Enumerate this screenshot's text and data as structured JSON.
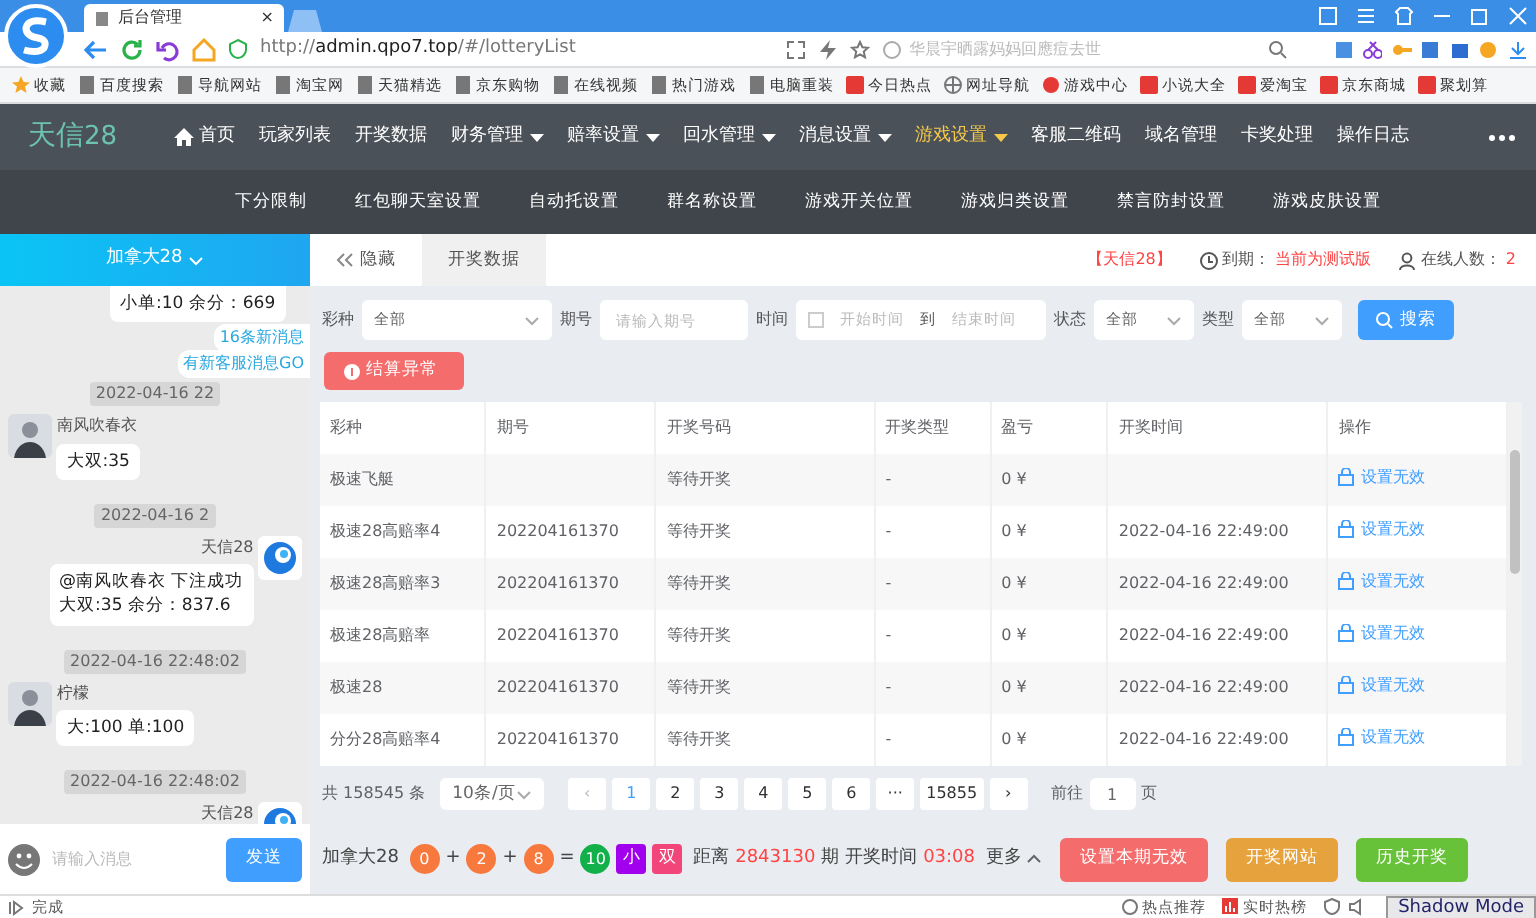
{
  "browser": {
    "tab_title": "后台管理",
    "tab_close": "×",
    "url_prefix": "http://",
    "url_host": "admin.qpo7.top",
    "url_path": "/#/lotteryList",
    "search_placeholder": "华晨宇晒露妈妈回應痘去世",
    "bookmarks": [
      {
        "label": "收藏",
        "kind": "star"
      },
      {
        "label": "百度搜索",
        "kind": "page"
      },
      {
        "label": "导航网站",
        "kind": "page"
      },
      {
        "label": "淘宝网",
        "kind": "page"
      },
      {
        "label": "天猫精选",
        "kind": "page"
      },
      {
        "label": "京东购物",
        "kind": "page"
      },
      {
        "label": "在线视频",
        "kind": "page"
      },
      {
        "label": "热门游戏",
        "kind": "page"
      },
      {
        "label": "电脑重装",
        "kind": "page"
      },
      {
        "label": "今日热点",
        "kind": "red"
      },
      {
        "label": "网址导航",
        "kind": "globe"
      },
      {
        "label": "游戏中心",
        "kind": "game"
      },
      {
        "label": "小说大全",
        "kind": "red"
      },
      {
        "label": "爱淘宝",
        "kind": "red"
      },
      {
        "label": "京东商城",
        "kind": "red"
      },
      {
        "label": "聚划算",
        "kind": "red"
      }
    ]
  },
  "app": {
    "logo_text": "天信",
    "logo_number": "28",
    "nav": [
      {
        "label": "首页",
        "kind": "home",
        "dropdown": false,
        "selected": false
      },
      {
        "label": "玩家列表",
        "dropdown": false,
        "selected": false
      },
      {
        "label": "开奖数据",
        "dropdown": false,
        "selected": false
      },
      {
        "label": "财务管理",
        "dropdown": true,
        "selected": false
      },
      {
        "label": "赔率设置",
        "dropdown": true,
        "selected": false
      },
      {
        "label": "回水管理",
        "dropdown": true,
        "selected": false
      },
      {
        "label": "消息设置",
        "dropdown": true,
        "selected": false
      },
      {
        "label": "游戏设置",
        "dropdown": true,
        "selected": true
      },
      {
        "label": "客服二维码",
        "dropdown": false,
        "selected": false
      },
      {
        "label": "域名管理",
        "dropdown": false,
        "selected": false
      },
      {
        "label": "卡奖处理",
        "dropdown": false,
        "selected": false
      },
      {
        "label": "操作日志",
        "dropdown": false,
        "selected": false
      }
    ],
    "subnav": [
      "下分限制",
      "红包聊天室设置",
      "自动托设置",
      "群名称设置",
      "游戏开关位置",
      "游戏归类设置",
      "禁言防封设置",
      "游戏皮肤设置"
    ]
  },
  "chat": {
    "room": "加拿大28",
    "notices": [
      "16条新消息",
      "有新客服消息GO"
    ],
    "messages": [
      {
        "kind": "bubble",
        "lines": [
          "小单:10 余分：669"
        ]
      },
      {
        "kind": "time",
        "text": "2022-04-16 22"
      },
      {
        "kind": "user",
        "sender": "南风吹春衣",
        "lines": [
          "大双:35"
        ]
      },
      {
        "kind": "time",
        "text": "2022-04-16 2"
      },
      {
        "kind": "bot",
        "sender": "天信28",
        "lines": [
          "@南风吹春衣 下注成功",
          "大双:35 余分：837.6"
        ]
      },
      {
        "kind": "time",
        "text": "2022-04-16 22:48:02"
      },
      {
        "kind": "user",
        "sender": "柠檬",
        "lines": [
          "大:100 单:100"
        ]
      },
      {
        "kind": "time",
        "text": "2022-04-16 22:48:02"
      },
      {
        "kind": "bot",
        "sender": "天信28"
      }
    ],
    "input_placeholder": "请输入消息",
    "send_label": "发送"
  },
  "tabs": [
    {
      "label": "隐藏",
      "kind": "hide",
      "selected": false
    },
    {
      "label": "开奖数据",
      "selected": true
    }
  ],
  "header_info": {
    "site": "【天信28】",
    "expiry_label": "到期：",
    "expiry_value": "当前为测试版",
    "online_label": "在线人数：",
    "online_value": "2"
  },
  "filters": [
    {
      "label": "彩种",
      "kind": "select",
      "value": "全部"
    },
    {
      "label": "期号",
      "kind": "input",
      "placeholder": "请输入期号"
    },
    {
      "label": "时间",
      "kind": "range",
      "from_placeholder": "开始时间",
      "separator": "到",
      "to_placeholder": "结束时间"
    },
    {
      "label": "状态",
      "kind": "select",
      "value": "全部"
    },
    {
      "label": "类型",
      "kind": "select",
      "value": "全部"
    }
  ],
  "search_label": "搜索",
  "alert_label": "结算异常",
  "table": {
    "columns": [
      "彩种",
      "期号",
      "开奖号码",
      "开奖类型",
      "盈亏",
      "开奖时间",
      "操作"
    ],
    "rows": [
      {
        "cells": [
          "极速飞艇",
          "",
          "等待开奖",
          "-",
          "0 ¥",
          ""
        ],
        "action": "设置无效"
      },
      {
        "cells": [
          "极速28高赔率4",
          "202204161370",
          "等待开奖",
          "-",
          "0 ¥",
          "2022-04-16 22:49:00"
        ],
        "action": "设置无效"
      },
      {
        "cells": [
          "极速28高赔率3",
          "202204161370",
          "等待开奖",
          "-",
          "0 ¥",
          "2022-04-16 22:49:00"
        ],
        "action": "设置无效"
      },
      {
        "cells": [
          "极速28高赔率",
          "202204161370",
          "等待开奖",
          "-",
          "0 ¥",
          "2022-04-16 22:49:00"
        ],
        "action": "设置无效"
      },
      {
        "cells": [
          "极速28",
          "202204161370",
          "等待开奖",
          "-",
          "0 ¥",
          "2022-04-16 22:49:00"
        ],
        "action": "设置无效"
      },
      {
        "cells": [
          "分分28高赔率4",
          "202204161370",
          "等待开奖",
          "-",
          "0 ¥",
          "2022-04-16 22:49:00"
        ],
        "action": "设置无效"
      }
    ]
  },
  "pagination": {
    "total": "共 158545 条",
    "page_size": "10条/页",
    "prev": "‹",
    "next": "›",
    "pages": [
      {
        "label": "1",
        "selected": true
      },
      {
        "label": "2",
        "selected": false
      },
      {
        "label": "3",
        "selected": false
      },
      {
        "label": "4",
        "selected": false
      },
      {
        "label": "5",
        "selected": false
      },
      {
        "label": "6",
        "selected": false
      },
      {
        "label": "···",
        "selected": false
      },
      {
        "label": "15855",
        "selected": false
      }
    ],
    "goto_label": "前往",
    "goto_value": "1",
    "goto_suffix": "页"
  },
  "draw_bar": {
    "game": "加拿大28",
    "result": [
      {
        "kind": "ball",
        "label": "0",
        "color": "#f7793e"
      },
      {
        "kind": "op",
        "label": "+"
      },
      {
        "kind": "ball",
        "label": "2",
        "color": "#f7793e"
      },
      {
        "kind": "op",
        "label": "+"
      },
      {
        "kind": "ball",
        "label": "8",
        "color": "#f7793e"
      },
      {
        "kind": "op",
        "label": "="
      },
      {
        "kind": "ball",
        "label": "10",
        "color": "#12b04a"
      },
      {
        "kind": "tag",
        "label": "小",
        "color": "#a000ee"
      },
      {
        "kind": "tag",
        "label": "双",
        "color": "#f2457a"
      }
    ],
    "distance_label": "距离",
    "period": "2843130",
    "time_label": "期 开奖时间",
    "countdown": "03:08",
    "more_label": "更多",
    "buttons": [
      {
        "label": "设置本期无效",
        "color": "#f56c6c"
      },
      {
        "label": "开奖网站",
        "color": "#e6a23c"
      },
      {
        "label": "历史开奖",
        "color": "#67c23a"
      }
    ]
  },
  "status_bar": {
    "left": "完成",
    "items": [
      "热点推荐",
      "实时热榜"
    ],
    "mode": "Shadow Mode"
  }
}
